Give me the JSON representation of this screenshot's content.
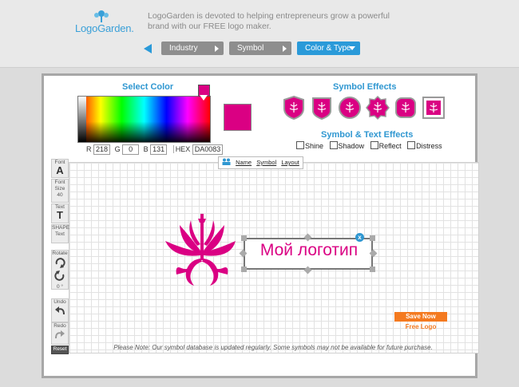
{
  "header": {
    "logo_text": "LogoGarden.",
    "tagline": "LogoGarden is devoted to helping entrepreneurs grow a powerful brand with our FREE logo maker."
  },
  "steps": [
    {
      "label": "Industry"
    },
    {
      "label": "Symbol"
    },
    {
      "label": "Color & Type"
    }
  ],
  "color_panel": {
    "title": "Select Color",
    "r_label": "R",
    "r": "218",
    "g_label": "G",
    "g": "0",
    "b_label": "B",
    "b": "131",
    "hex_label": "HEX",
    "hex": "DA0083",
    "selected_color": "#da0083"
  },
  "symbol_effects": {
    "title": "Symbol Effects",
    "icons": [
      "shield-effect-icon",
      "badge-effect-icon",
      "circle-effect-icon",
      "burst-effect-icon",
      "rounded-effect-icon",
      "square-effect-icon"
    ]
  },
  "text_effects": {
    "title": "Symbol & Text Effects",
    "options": [
      {
        "label": "Shine"
      },
      {
        "label": "Shadow"
      },
      {
        "label": "Reflect"
      },
      {
        "label": "Distress"
      }
    ]
  },
  "canvas_tabs": {
    "name": "Name",
    "symbol": "Symbol",
    "layout": "Layout"
  },
  "toolbar": {
    "font_label": "Font",
    "font_glyph": "A",
    "font_size_label": "Font Size",
    "font_size_value": "40",
    "text_label": "Text",
    "text_glyph": "T",
    "shape_label": "SHAPE",
    "shape_text_label": "Text",
    "rotate_label": "Rotate",
    "rotate_value": "0 °",
    "undo_label": "Undo",
    "redo_label": "Redo",
    "reset_label": "Reset"
  },
  "canvas": {
    "logo_text": "Мой логотип",
    "save_label": "Save Now",
    "free_label": "Free Logo",
    "note": "Please Note: Our symbol database is updated regularly. Some symbols may not be available for future purchase."
  },
  "colors": {
    "accent": "#2f97d1",
    "brand_pink": "#da0083",
    "cta_orange": "#f47a20"
  }
}
